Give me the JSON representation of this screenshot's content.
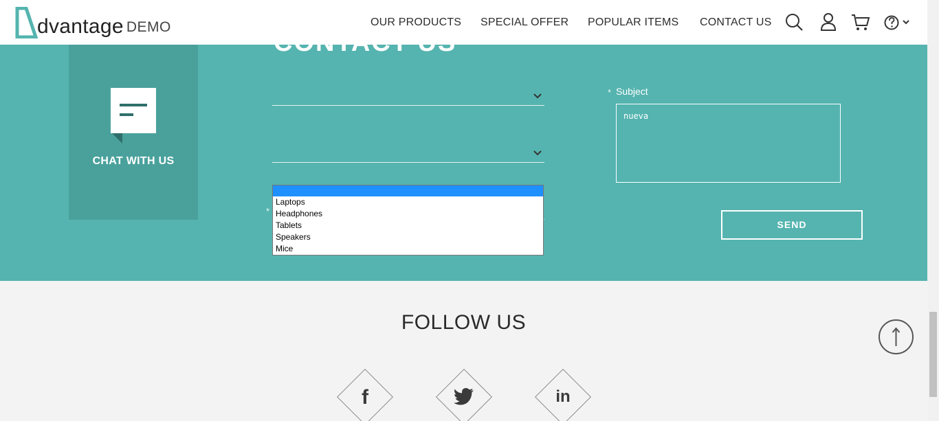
{
  "header": {
    "logo_word": "dvantage",
    "logo_demo": "DEMO",
    "nav": [
      {
        "label": "OUR PRODUCTS"
      },
      {
        "label": "SPECIAL OFFER"
      },
      {
        "label": "POPULAR ITEMS"
      },
      {
        "label": "CONTACT US"
      }
    ]
  },
  "contact": {
    "title": "CONTACT US",
    "chat_label": "CHAT WITH US",
    "required_marker": "*",
    "subject_label": "Subject",
    "subject_value": "nueva",
    "send_label": "SEND",
    "dropdown_options": [
      "Laptops",
      "Headphones",
      "Tablets",
      "Speakers",
      "Mice"
    ]
  },
  "follow": {
    "title": "FOLLOW US",
    "networks": [
      {
        "icon": "facebook-icon",
        "glyph": "f"
      },
      {
        "icon": "twitter-icon",
        "glyph": ""
      },
      {
        "icon": "linkedin-icon",
        "glyph": "in"
      }
    ]
  },
  "colors": {
    "band": "#55b4af",
    "chat_box": "#4aa19c",
    "dropdown_highlight": "#1e90ff"
  }
}
